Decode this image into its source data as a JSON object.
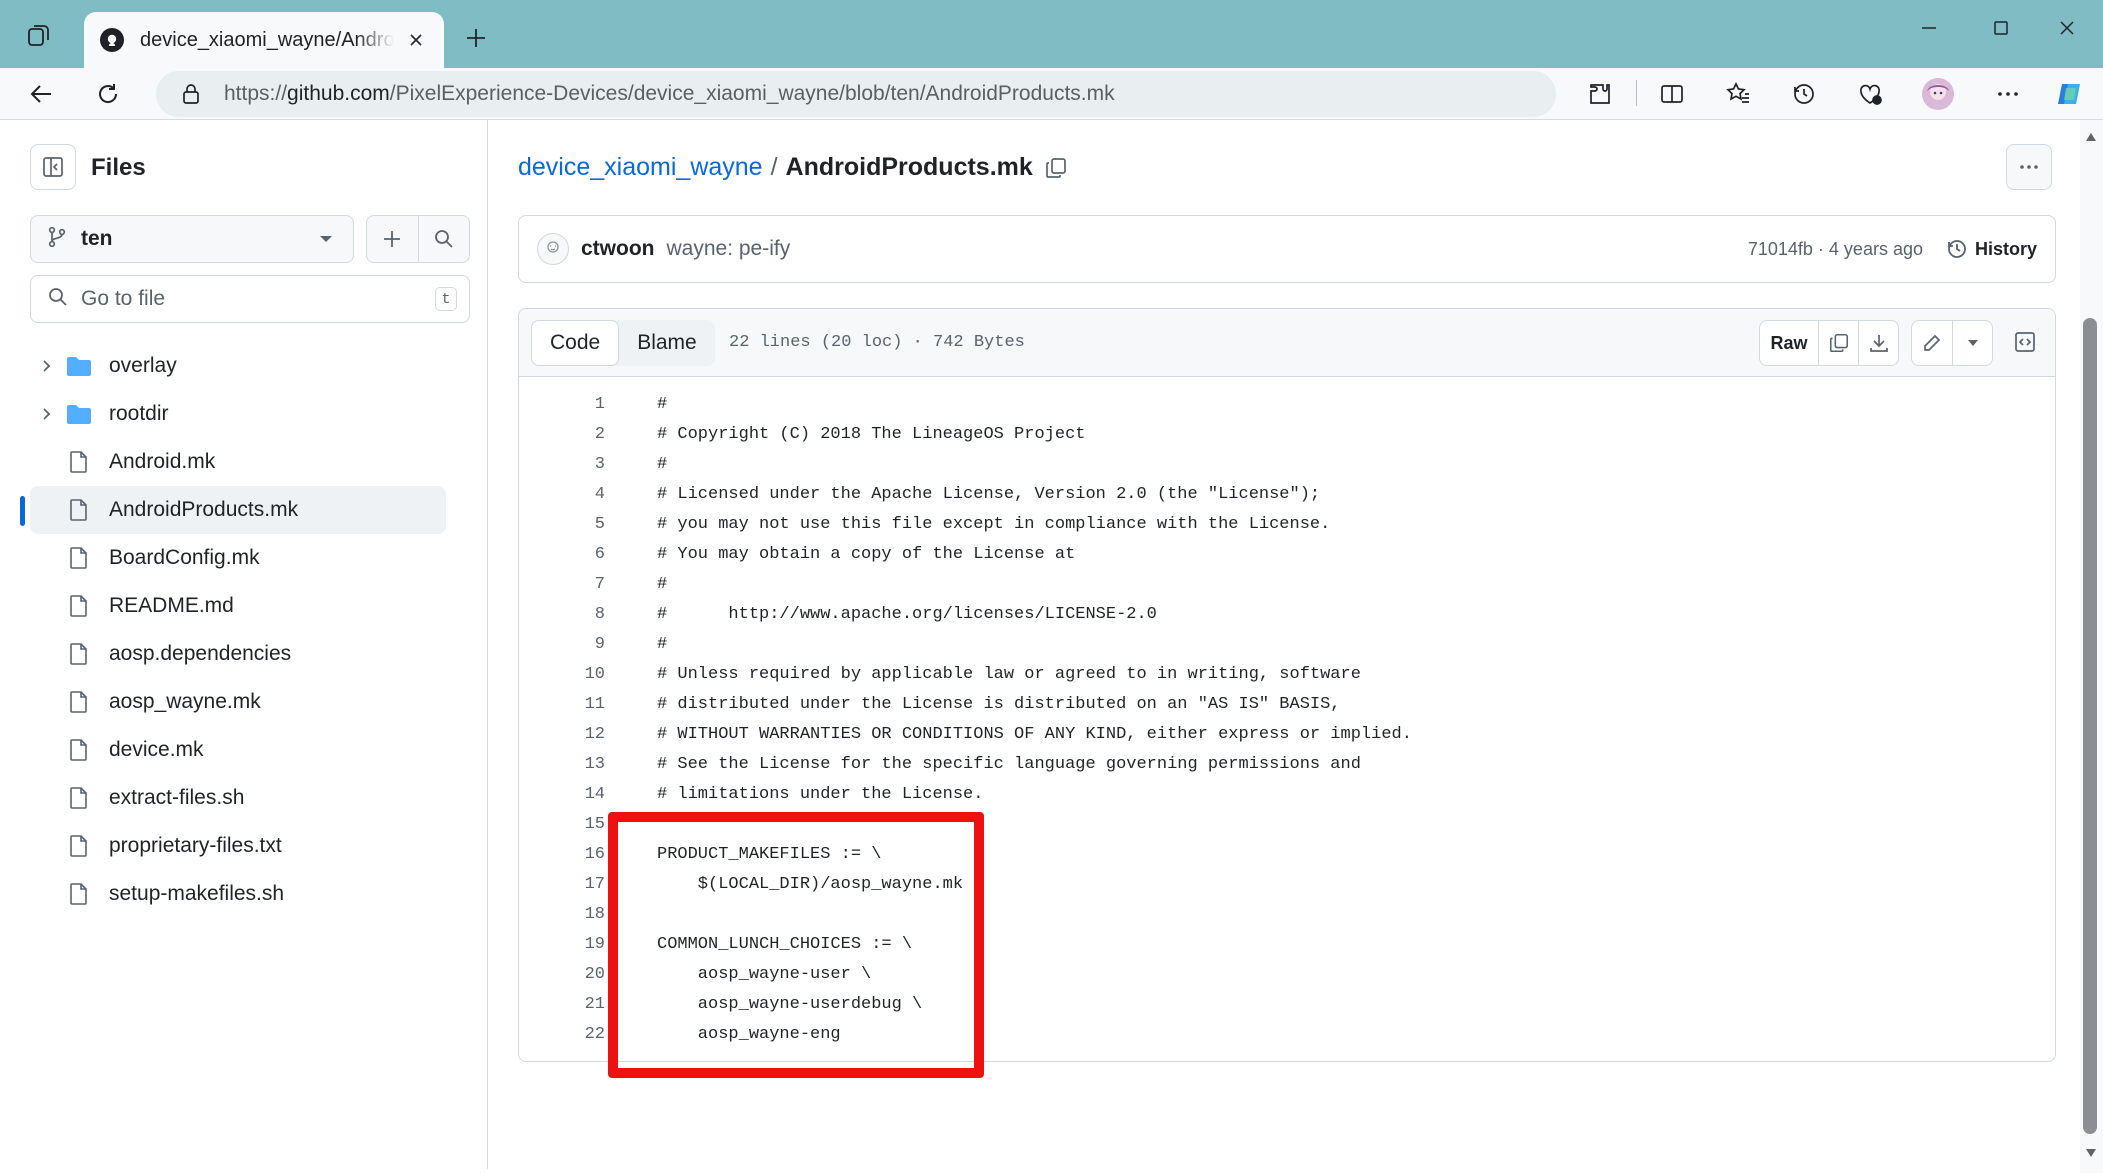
{
  "browser": {
    "tab_title": "device_xiaomi_wayne/AndroidProducts.mk",
    "url_prefix": "https://",
    "url_host": "github.com",
    "url_path": "/PixelExperience-Devices/device_xiaomi_wayne/blob/ten/AndroidProducts.mk"
  },
  "sidebar": {
    "title": "Files",
    "branch": "ten",
    "search_placeholder": "Go to file",
    "search_shortcut": "t",
    "items": [
      {
        "label": "overlay",
        "type": "folder"
      },
      {
        "label": "rootdir",
        "type": "folder"
      },
      {
        "label": "Android.mk",
        "type": "file"
      },
      {
        "label": "AndroidProducts.mk",
        "type": "file",
        "active": true
      },
      {
        "label": "BoardConfig.mk",
        "type": "file"
      },
      {
        "label": "README.md",
        "type": "file"
      },
      {
        "label": "aosp.dependencies",
        "type": "file"
      },
      {
        "label": "aosp_wayne.mk",
        "type": "file"
      },
      {
        "label": "device.mk",
        "type": "file"
      },
      {
        "label": "extract-files.sh",
        "type": "file"
      },
      {
        "label": "proprietary-files.txt",
        "type": "file"
      },
      {
        "label": "setup-makefiles.sh",
        "type": "file"
      }
    ]
  },
  "breadcrumb": {
    "repo": "device_xiaomi_wayne",
    "separator": "/",
    "file": "AndroidProducts.mk"
  },
  "commit": {
    "author": "ctwoon",
    "message": "wayne: pe-ify",
    "meta": "71014fb · 4 years ago",
    "history_label": "History"
  },
  "file_header": {
    "tab_code": "Code",
    "tab_blame": "Blame",
    "stats": "22 lines (20 loc) · 742 Bytes",
    "raw_label": "Raw"
  },
  "code_lines": [
    "#",
    "# Copyright (C) 2018 The LineageOS Project",
    "#",
    "# Licensed under the Apache License, Version 2.0 (the \"License\");",
    "# you may not use this file except in compliance with the License.",
    "# You may obtain a copy of the License at",
    "#",
    "#      http://www.apache.org/licenses/LICENSE-2.0",
    "#",
    "# Unless required by applicable law or agreed to in writing, software",
    "# distributed under the License is distributed on an \"AS IS\" BASIS,",
    "# WITHOUT WARRANTIES OR CONDITIONS OF ANY KIND, either express or implied.",
    "# See the License for the specific language governing permissions and",
    "# limitations under the License.",
    "",
    "PRODUCT_MAKEFILES := \\",
    "    $(LOCAL_DIR)/aosp_wayne.mk",
    "",
    "COMMON_LUNCH_CHOICES := \\",
    "    aosp_wayne-user \\",
    "    aosp_wayne-userdebug \\",
    "    aosp_wayne-eng"
  ],
  "colors": {
    "tabbar": "#7fbcc3",
    "link": "#0969da",
    "highlight": "#ee1111",
    "folder": "#54aeff"
  }
}
